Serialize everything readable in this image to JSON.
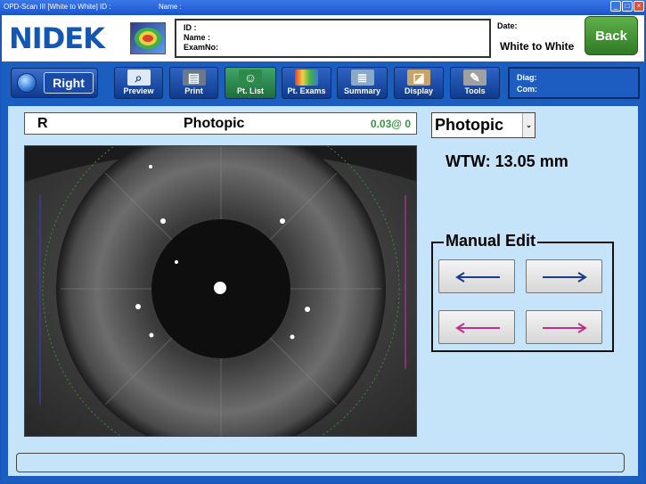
{
  "window": {
    "title": "OPD-Scan III [White to White] ID :",
    "name_label": "Name :"
  },
  "header": {
    "logo": "NIDEK",
    "id_label": "ID :",
    "name_label": "Name :",
    "examno_label": "ExamNo:",
    "date_label": "Date:",
    "exam_type": "White to White",
    "back_label": "Back"
  },
  "toolbar": {
    "eye_label": "Right",
    "buttons": [
      "Preview",
      "Print",
      "Pt. List",
      "Pt. Exams",
      "Summary",
      "Display",
      "Tools"
    ],
    "diag_label": "Diag:",
    "com_label": "Com:"
  },
  "image_panel": {
    "eye": "R",
    "mode": "Photopic",
    "value": "0.03@  0"
  },
  "side": {
    "mode_selected": "Photopic",
    "wtw_text": "WTW: 13.05 mm",
    "manual_edit_title": "Manual Edit"
  },
  "colors": {
    "accent_blue": "#1a5fbf",
    "panel_bg": "#c5e4fa",
    "back_green": "#3d8f2e",
    "left_arrow_top": "#1c3a8c",
    "magenta_arrow": "#c0308a"
  }
}
